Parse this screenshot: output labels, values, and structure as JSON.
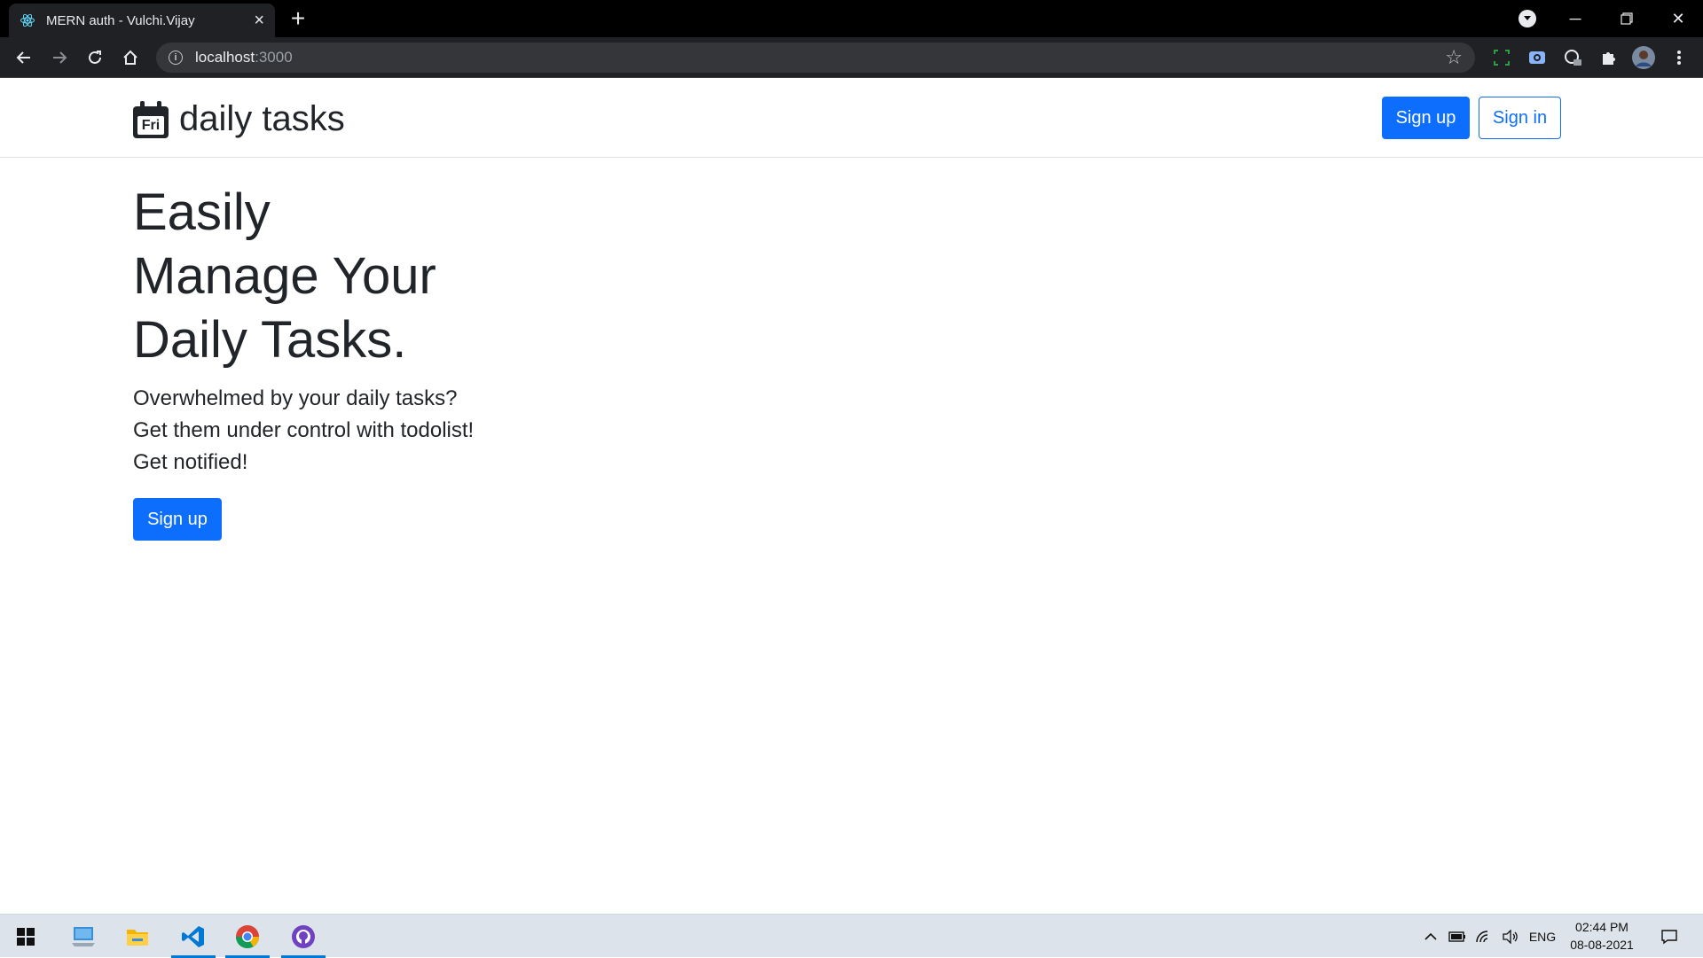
{
  "browser": {
    "tab_title": "MERN auth - Vulchi.Vijay",
    "url_host": "localhost",
    "url_port": ":3000"
  },
  "navbar": {
    "brand_day": "Fri",
    "brand_text": "daily tasks",
    "signup_label": "Sign up",
    "signin_label": "Sign in"
  },
  "hero": {
    "title_lines": [
      "Easily",
      "Manage Your",
      "Daily Tasks."
    ],
    "text_lines": [
      "Overwhelmed by your daily tasks?",
      "Get them under control with todolist!",
      "Get notified!"
    ],
    "cta_label": "Sign up"
  },
  "taskbar": {
    "language": "ENG",
    "time": "02:44 PM",
    "date": "08-08-2021"
  },
  "colors": {
    "primary": "#0d6efd",
    "text": "#212529"
  }
}
